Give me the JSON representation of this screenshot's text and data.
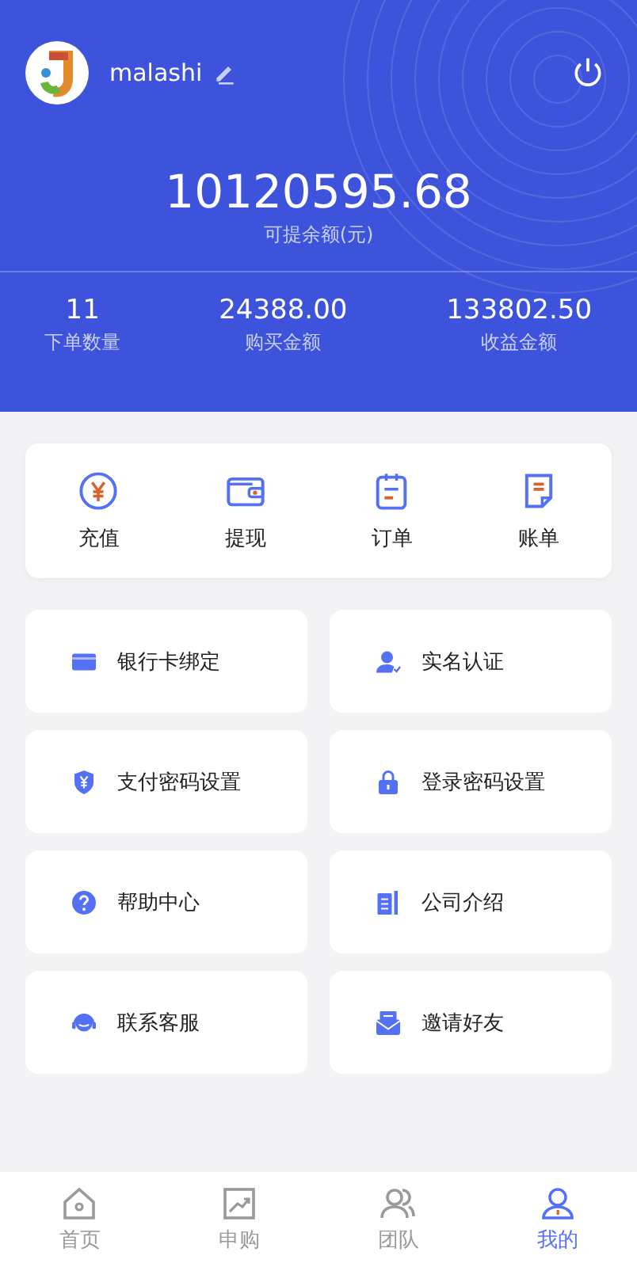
{
  "profile": {
    "username": "malashi"
  },
  "balance": {
    "amount": "10120595.68",
    "label": "可提余额(元)"
  },
  "stats": [
    {
      "value": "11",
      "label": "下单数量"
    },
    {
      "value": "24388.00",
      "label": "购买金额"
    },
    {
      "value": "133802.50",
      "label": "收益金额"
    }
  ],
  "quick_actions": [
    {
      "label": "充值"
    },
    {
      "label": "提现"
    },
    {
      "label": "订单"
    },
    {
      "label": "账单"
    }
  ],
  "menu": [
    {
      "label": "银行卡绑定"
    },
    {
      "label": "实名认证"
    },
    {
      "label": "支付密码设置"
    },
    {
      "label": "登录密码设置"
    },
    {
      "label": "帮助中心"
    },
    {
      "label": "公司介绍"
    },
    {
      "label": "联系客服"
    },
    {
      "label": "邀请好友"
    }
  ],
  "tabs": [
    {
      "label": "首页",
      "selected": false
    },
    {
      "label": "申购",
      "selected": false
    },
    {
      "label": "团队",
      "selected": false
    },
    {
      "label": "我的",
      "selected": true
    }
  ]
}
